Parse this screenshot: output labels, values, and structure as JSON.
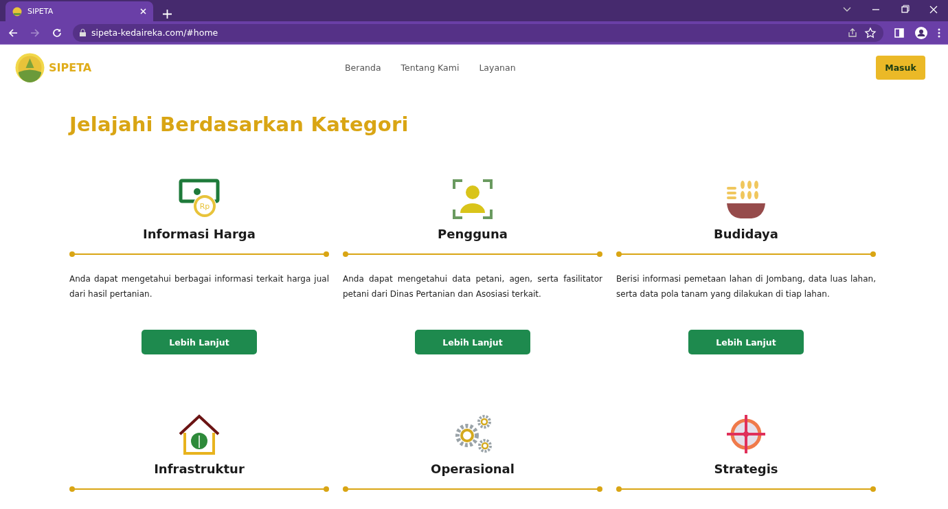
{
  "browser": {
    "tab_title": "SIPETA",
    "url": "sipeta-kedaireka.com/#home"
  },
  "header": {
    "logo_text": "SIPETA",
    "nav": [
      {
        "label": "Beranda"
      },
      {
        "label": "Tentang Kami"
      },
      {
        "label": "Layanan"
      }
    ],
    "login_button": "Masuk"
  },
  "section_title": "Jelajahi Berdasarkan Kategori",
  "categories": [
    {
      "kind": "money",
      "icon_text": "Rp",
      "title": "Informasi Harga",
      "description": "Anda dapat mengetahui berbagai informasi terkait harga jual dari hasil pertanian.",
      "button": "Lebih Lanjut"
    },
    {
      "kind": "user",
      "title": "Pengguna",
      "description": "Anda dapat mengetahui data petani, agen, serta fasilitator petani dari Dinas Pertanian dan Asosiasi terkait.",
      "button": "Lebih Lanjut"
    },
    {
      "kind": "grain",
      "title": "Budidaya",
      "description": "Berisi informasi pemetaan lahan di Jombang, data luas lahan, serta data pola tanam yang dilakukan di tiap lahan.",
      "button": "Lebih Lanjut"
    },
    {
      "kind": "house",
      "title": "Infrastruktur"
    },
    {
      "kind": "gears",
      "title": "Operasional"
    },
    {
      "kind": "target",
      "title": "Strategis"
    }
  ]
}
